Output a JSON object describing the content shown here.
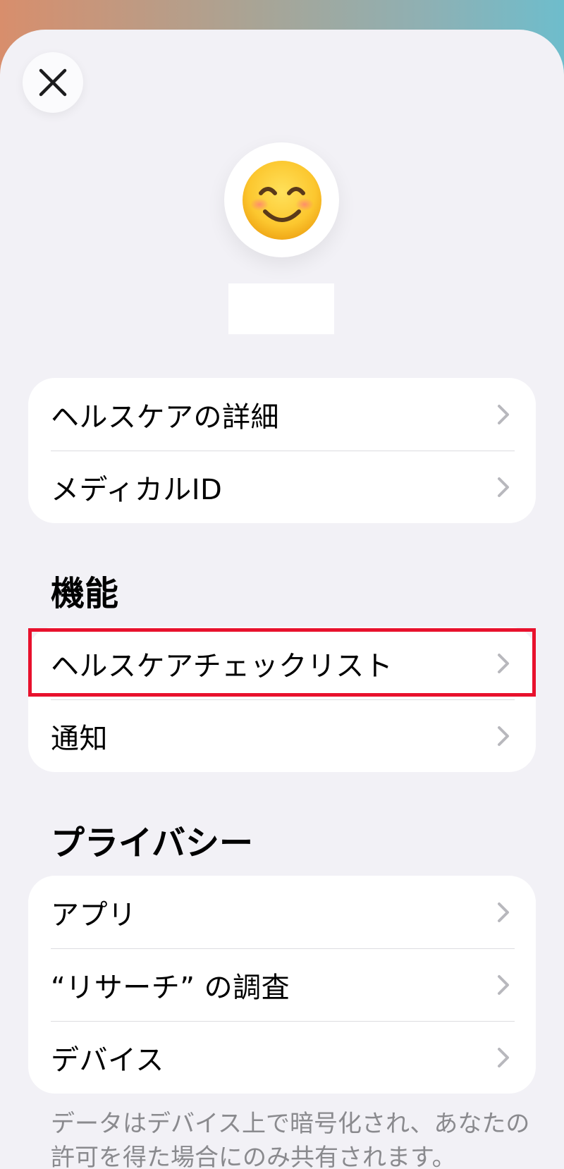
{
  "colors": {
    "accent_highlight": "#e8112d",
    "sheet_bg": "#f2f1f6",
    "secondary_text": "#8a8a8e"
  },
  "header": {
    "close_icon": "close-icon",
    "avatar_emoji": "😊"
  },
  "group1": [
    {
      "label": "ヘルスケアの詳細"
    },
    {
      "label": "メディカルID"
    }
  ],
  "features": {
    "title": "機能",
    "items": [
      {
        "label": "ヘルスケアチェックリスト"
      },
      {
        "label": "通知"
      }
    ]
  },
  "privacy": {
    "title": "プライバシー",
    "items": [
      {
        "label": "アプリ"
      },
      {
        "label": "“リサーチ” の調査"
      },
      {
        "label": "デバイス"
      }
    ]
  },
  "footnote": "データはデバイス上で暗号化され、あなたの許可を得た場合にのみ共有されます。"
}
